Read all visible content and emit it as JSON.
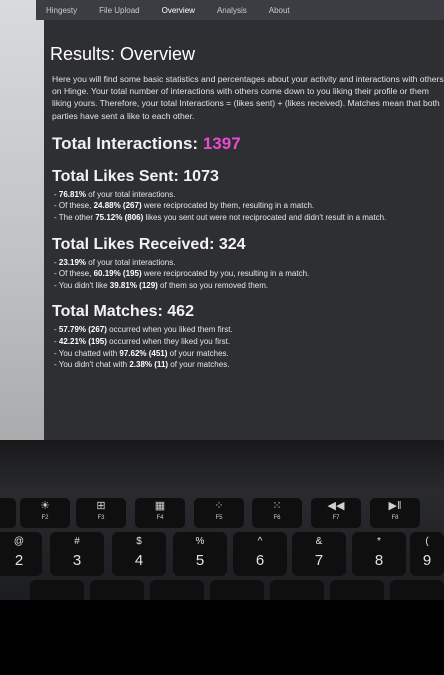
{
  "nav": {
    "items": [
      "Hingesty",
      "File Upload",
      "Overview",
      "Analysis",
      "About"
    ],
    "active_index": 2
  },
  "page": {
    "title": "Results: Overview",
    "intro": "Here you will find some basic statistics and percentages about your activity and interactions with others on Hinge. Your total number of interactions with others come down to you liking their profile or them liking yours. Therefore, your total Interactions = (likes sent) + (likes received). Matches mean that both parties have sent a like to each other.",
    "total_interactions_label": "Total Interactions:",
    "total_interactions_value": "1397",
    "sections": [
      {
        "heading": "Total Likes Sent: 1073",
        "bullets": [
          {
            "pre": "- ",
            "bold": "76.81%",
            "post": " of your total interactions."
          },
          {
            "pre": "- Of these, ",
            "bold": "24.88% (267)",
            "post": " were reciprocated by them, resulting in a match."
          },
          {
            "pre": "- The other ",
            "bold": "75.12% (806)",
            "post": " likes you sent out were not reciprocated and didn't result in a match."
          }
        ]
      },
      {
        "heading": "Total Likes Received: 324",
        "bullets": [
          {
            "pre": "- ",
            "bold": "23.19%",
            "post": " of your total interactions."
          },
          {
            "pre": "- Of these, ",
            "bold": "60.19% (195)",
            "post": " were reciprocated by you, resulting in a match."
          },
          {
            "pre": "- You didn't like ",
            "bold": "39.81% (129)",
            "post": " of them so you removed them."
          }
        ]
      },
      {
        "heading": "Total Matches: 462",
        "bullets": [
          {
            "pre": "- ",
            "bold": "57.79% (267)",
            "post": " occurred when you liked them first."
          },
          {
            "pre": "- ",
            "bold": "42.21% (195)",
            "post": " occurred when they liked you first."
          },
          {
            "pre": "- You chatted with ",
            "bold": "97.62% (451)",
            "post": " of your matches."
          },
          {
            "pre": "- You didn't chat with ",
            "bold": "2.38% (11)",
            "post": " of your matches."
          }
        ]
      }
    ]
  },
  "keyboard": {
    "fkeys": [
      {
        "icon": "☀",
        "label": "F2"
      },
      {
        "icon": "⊞",
        "label": "F3"
      },
      {
        "icon": "▦",
        "label": "F4"
      },
      {
        "icon": "⁘",
        "label": "F5"
      },
      {
        "icon": "⁙",
        "label": "F6"
      },
      {
        "icon": "◀◀",
        "label": "F7"
      },
      {
        "icon": "▶ǁ",
        "label": "F8"
      }
    ],
    "number_keys": [
      {
        "sym": "@",
        "dig": "2"
      },
      {
        "sym": "#",
        "dig": "3"
      },
      {
        "sym": "$",
        "dig": "4"
      },
      {
        "sym": "%",
        "dig": "5"
      },
      {
        "sym": "^",
        "dig": "6"
      },
      {
        "sym": "&",
        "dig": "7"
      },
      {
        "sym": "*",
        "dig": "8"
      },
      {
        "sym": "(",
        "dig": "9"
      }
    ]
  }
}
